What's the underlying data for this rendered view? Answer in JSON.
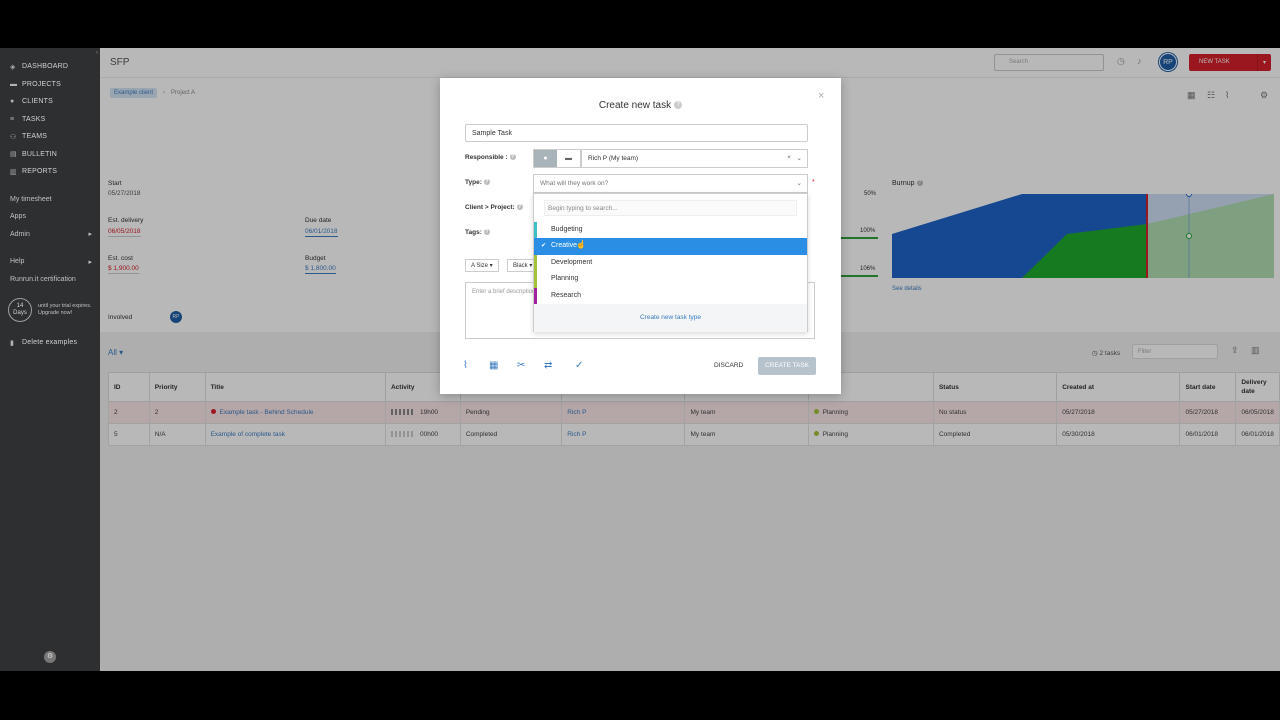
{
  "sidebar": {
    "nav": [
      {
        "label": "DASHBOARD",
        "icon": "dashboard-icon"
      },
      {
        "label": "PROJECTS",
        "icon": "folder-icon"
      },
      {
        "label": "CLIENTS",
        "icon": "person-icon"
      },
      {
        "label": "TASKS",
        "icon": "list-icon"
      },
      {
        "label": "TEAMS",
        "icon": "people-icon"
      },
      {
        "label": "BULLETIN",
        "icon": "bulletin-icon"
      },
      {
        "label": "REPORTS",
        "icon": "chart-icon"
      }
    ],
    "links": [
      "My timesheet",
      "Apps",
      "Admin"
    ],
    "help": "Help",
    "certification": "Runrun.it certification",
    "trial_days": "14",
    "trial_unit": "Days",
    "trial_text_1": "until your trial expires.",
    "trial_text_2": "Upgrade now!",
    "delete_examples": "Delete examples"
  },
  "header": {
    "project_title": "SFP",
    "search_placeholder": "Search",
    "avatar": "RP",
    "new_task": "NEW TASK"
  },
  "breadcrumb": {
    "client": "Example client",
    "project": "Project A"
  },
  "project": {
    "start_label": "Start",
    "start_value": "05/27/2018",
    "est_delivery_label": "Est. delivery",
    "est_delivery_value": "06/05/2018",
    "due_date_label": "Due date",
    "due_date_value": "06/01/2018",
    "est_cost_label": "Est. cost",
    "est_cost_value": "$ 1,900.00",
    "budget_label": "Budget",
    "budget_value": "$ 1,800.00",
    "pct_1": "50%",
    "pct_2": "100%",
    "pct_3": "106%",
    "burnup_label": "Burnup",
    "see_details": "See details",
    "involved_label": "Involved",
    "involved_avatar": "RP"
  },
  "tasks": {
    "filter": "All",
    "count": "2 tasks",
    "filter_placeholder": "Filter",
    "columns": [
      "ID",
      "Priority",
      "Title",
      "Activity",
      "",
      "",
      "",
      "",
      "Status",
      "Created at",
      "Start date",
      "Delivery date"
    ],
    "rows": [
      {
        "id": "2",
        "priority": "2",
        "title": "Example task - Behind Schedule",
        "time": "19h00",
        "state": "Pending",
        "assignee": "Rich P",
        "team": "My team",
        "type": "Planning",
        "status": "No status",
        "created": "05/27/2018",
        "start": "05/27/2018",
        "delivery": "06/05/2018"
      },
      {
        "id": "5",
        "priority": "N/A",
        "title": "Example of complete task",
        "time": "00h00",
        "state": "Completed",
        "assignee": "Rich P",
        "team": "My team",
        "type": "Planning",
        "status": "Completed",
        "created": "05/30/2018",
        "start": "06/01/2018",
        "delivery": "06/01/2018"
      }
    ]
  },
  "modal": {
    "title": "Create new task",
    "task_name": "Sample Task",
    "responsible_label": "Responsible :",
    "responsible_value": "Rich P (My team)",
    "type_label": "Type:",
    "type_placeholder": "What will they work on?",
    "client_project_label": "Client > Project:",
    "tags_label": "Tags:",
    "size_btn": "Size",
    "color_btn": "Black",
    "description_placeholder": "Enter a brief description",
    "discard": "DISCARD",
    "create": "CREATE TASK"
  },
  "type_dropdown": {
    "search_placeholder": "Begin typing to search...",
    "items": [
      {
        "label": "Budgeting",
        "color": "#3cc1c8"
      },
      {
        "label": "Creative",
        "color": "#2b8ee5",
        "selected": true
      },
      {
        "label": "Development",
        "color": "#a3c23a"
      },
      {
        "label": "Planning",
        "color": "#a3c23a"
      },
      {
        "label": "Research",
        "color": "#a020a0"
      }
    ],
    "create_type": "Create new task type"
  },
  "colors": {
    "accent": "#3b7cc1",
    "danger": "#d7212b",
    "selected": "#2b8ee5",
    "chart_blue": "#1e64c8",
    "chart_green": "#1faa2e"
  }
}
